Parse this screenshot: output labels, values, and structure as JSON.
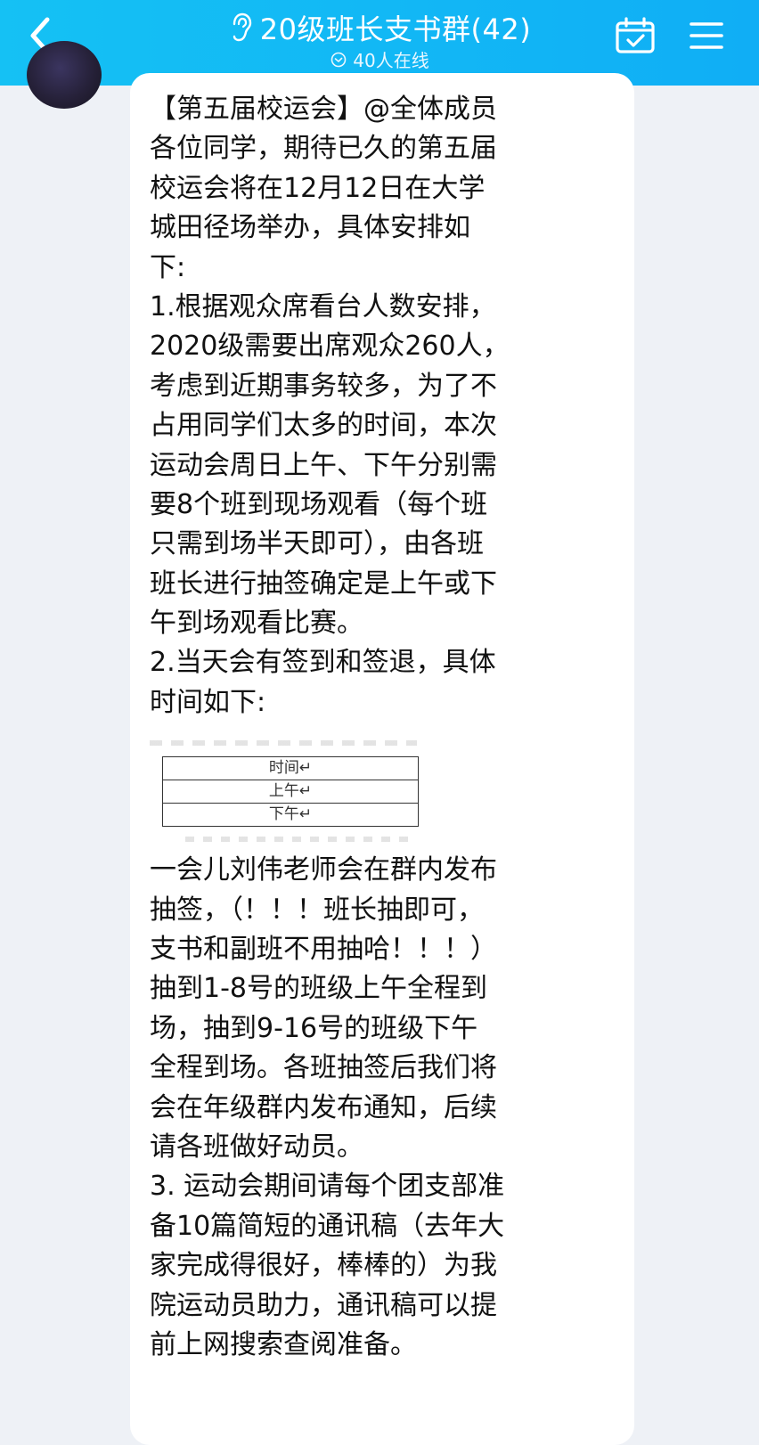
{
  "header": {
    "back_icon": "chevron-left-icon",
    "group_icon": "ear-icon",
    "title": "20级班长支书群(42)",
    "online_icon": "check-circle-icon",
    "subtitle": "40人在线",
    "calendar_icon": "calendar-check-icon",
    "menu_icon": "hamburger-menu-icon"
  },
  "message": {
    "lines_part1": [
      "【第五届校运会】@全体成员",
      "各位同学，期待已久的第五届",
      "校运会将在12月12日在大学",
      "城田径场举办，具体安排如",
      "下:",
      "1.根据观众席看台人数安排，",
      "2020级需要出席观众260人，",
      "考虑到近期事务较多，为了不",
      "占用同学们太多的时间，本次",
      "运动会周日上午、下午分别需",
      "要8个班到现场观看（每个班",
      "只需到场半天即可），由各班",
      "班长进行抽签确定是上午或下",
      "午到场观看比赛。",
      "2.当天会有签到和签退，具体",
      "时间如下:"
    ],
    "table": {
      "rows": [
        "时间↵",
        "上午↵",
        "下午↵"
      ]
    },
    "lines_part2": [
      "一会儿刘伟老师会在群内发布",
      "抽签，（！！！班长抽即可，",
      "支书和副班不用抽哈！！！）",
      "抽到1-8号的班级上午全程到",
      "场，抽到9-16号的班级下午",
      "全程到场。各班抽签后我们将",
      "会在年级群内发布通知，后续",
      "请各班做好动员。",
      "3. 运动会期间请每个团支部准",
      "备10篇简短的通讯稿（去年大",
      "家完成得很好，棒棒的）为我",
      "院运动员助力，通讯稿可以提",
      "前上网搜索查阅准备。"
    ]
  }
}
